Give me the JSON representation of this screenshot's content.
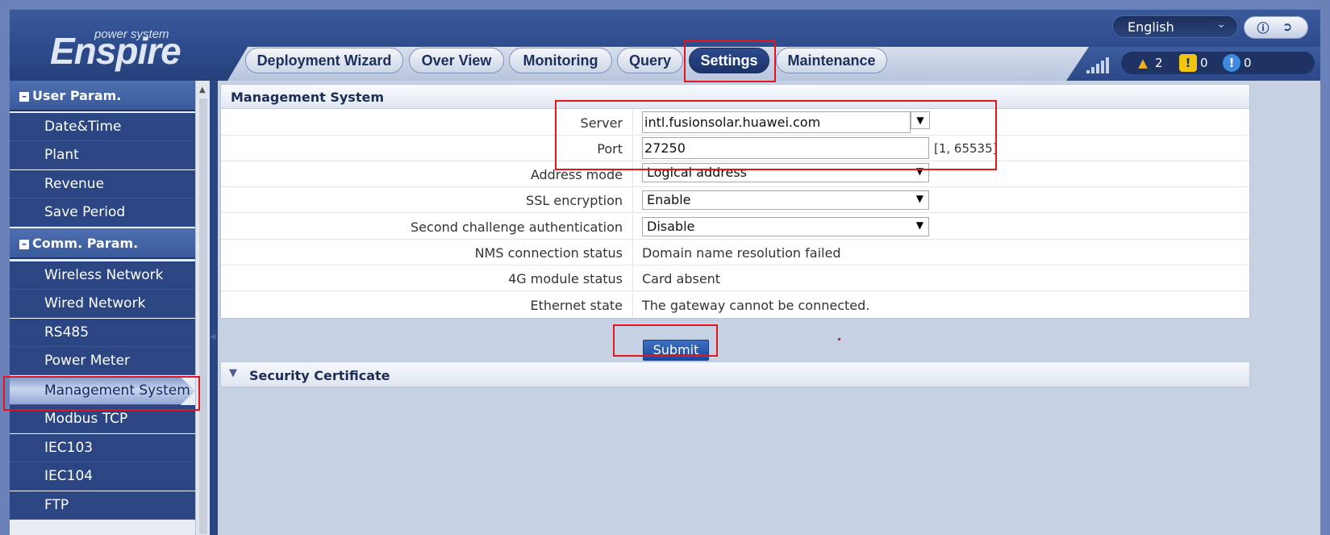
{
  "app": {
    "logo_small": "power system",
    "logo_big": "Enspire",
    "language": "English"
  },
  "tabs": [
    "Deployment Wizard",
    "Over View",
    "Monitoring",
    "Query",
    "Settings",
    "Maintenance"
  ],
  "active_tab": "Settings",
  "alarms": {
    "major": "2",
    "minor": "0",
    "warning": "0"
  },
  "sidebar": {
    "sections": [
      {
        "label": "User Param.",
        "items": [
          "Date&Time",
          "Plant",
          "Revenue",
          "Save Period"
        ]
      },
      {
        "label": "Comm. Param.",
        "items": [
          "Wireless Network",
          "Wired Network",
          "RS485",
          "Power Meter",
          "Management System",
          "Modbus TCP",
          "IEC103",
          "IEC104",
          "FTP"
        ]
      }
    ],
    "active_item": "Management System"
  },
  "panel": {
    "title": "Management System",
    "server_label": "Server",
    "server_value": "intl.fusionsolar.huawei.com",
    "port_label": "Port",
    "port_value": "27250",
    "port_range": "[1, 65535]",
    "address_mode_label": "Address mode",
    "address_mode_value": "Logical address",
    "ssl_label": "SSL encryption",
    "ssl_value": "Enable",
    "second_auth_label": "Second challenge authentication",
    "second_auth_value": "Disable",
    "nms_label": "NMS connection status",
    "nms_value": "Domain name resolution failed",
    "module_label": "4G module status",
    "module_value": "Card absent",
    "ethernet_label": "Ethernet state",
    "ethernet_value": "The gateway cannot be connected."
  },
  "submit_label": "Submit",
  "security_certificate": "Security Certificate",
  "colors": {
    "highlight": "#e3151d",
    "nav_bg": "#2c4683",
    "accent": "#1b4aa0"
  }
}
